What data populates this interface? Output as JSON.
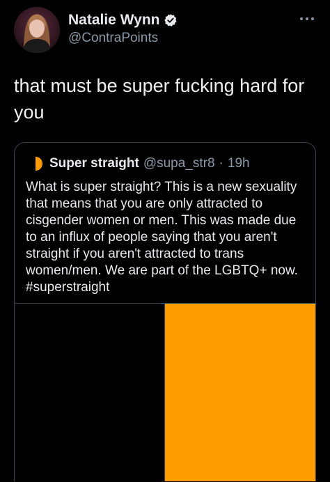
{
  "author": {
    "name": "Natalie Wynn",
    "handle": "@ContraPoints",
    "avatar_icon": "profile-photo",
    "verified_icon": "verified-badge-icon"
  },
  "more_icon": "more-options-icon",
  "tweet_text": "that must be super fucking hard for you",
  "quoted_tweet": {
    "avatar_icon": "orange-half-circle-icon",
    "name": "Super straight",
    "handle": "@supa_str8",
    "separator": "·",
    "time": "19h",
    "text": "What is super straight? This is a new sexuality that means that you are only attracted to cisgender women or men. This was made due to an influx of people saying that you aren't straight if you aren't attracted to trans women/men. We are part of the LGBTQ+ now. #superstraight",
    "media": {
      "left_color": "#000000",
      "right_color": "#ff9d00"
    }
  },
  "colors": {
    "background": "#000000",
    "text_primary": "#e7e9ea",
    "text_secondary": "#8b98a5",
    "border": "#38444d",
    "accent_orange": "#ff9d00"
  }
}
